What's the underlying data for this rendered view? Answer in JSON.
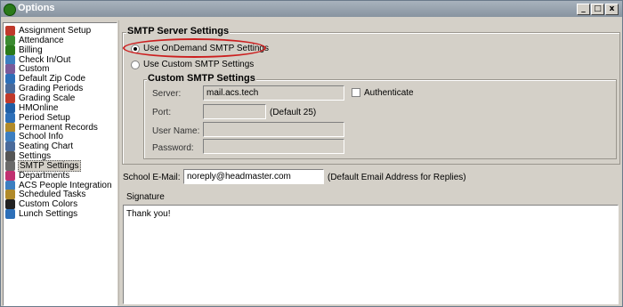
{
  "window": {
    "title": "Options",
    "min_label": "_",
    "max_label": "□",
    "close_label": "x"
  },
  "nav": {
    "selected": "SMTP Settings",
    "items": [
      {
        "label": "Assignment Setup",
        "icon": "target-icon",
        "color": "#c0392b"
      },
      {
        "label": "Attendance",
        "icon": "attendance-icon",
        "color": "#3b8a2f"
      },
      {
        "label": "Billing",
        "icon": "dollar-icon",
        "color": "#2a7a1a"
      },
      {
        "label": "Check In/Out",
        "icon": "check-in-out-icon",
        "color": "#3c7ec0"
      },
      {
        "label": "Custom",
        "icon": "custom-icon",
        "color": "#7a5a9a"
      },
      {
        "label": "Default Zip Code",
        "icon": "globe-icon",
        "color": "#2d6fb8"
      },
      {
        "label": "Grading Periods",
        "icon": "calendar-icon",
        "color": "#4a6a9a"
      },
      {
        "label": "Grading Scale",
        "icon": "target-icon",
        "color": "#c0392b"
      },
      {
        "label": "HMOnline",
        "icon": "globe-icon",
        "color": "#1f5fa6"
      },
      {
        "label": "Period Setup",
        "icon": "clock-icon",
        "color": "#2d6fb8"
      },
      {
        "label": "Permanent Records",
        "icon": "folder-icon",
        "color": "#b08a2a"
      },
      {
        "label": "School Info",
        "icon": "school-icon",
        "color": "#3c7ec0"
      },
      {
        "label": "Seating Chart",
        "icon": "chart-icon",
        "color": "#4a6a9a"
      },
      {
        "label": "Settings",
        "icon": "settings-icon",
        "color": "#555555"
      },
      {
        "label": "SMTP Settings",
        "icon": "mail-icon",
        "color": "#6a6a6a"
      },
      {
        "label": "Departments",
        "icon": "departments-icon",
        "color": "#c03070"
      },
      {
        "label": "ACS People Integration",
        "icon": "people-icon",
        "color": "#3c7ec0"
      },
      {
        "label": "Scheduled Tasks",
        "icon": "tasks-icon",
        "color": "#b08a2a"
      },
      {
        "label": "Custom Colors",
        "icon": "palette-icon",
        "color": "#222222"
      },
      {
        "label": "Lunch Settings",
        "icon": "lunch-icon",
        "color": "#2d6fb8"
      }
    ]
  },
  "smtp": {
    "group_title": "SMTP Server Settings",
    "option_ondemand": "Use OnDemand SMTP Settings",
    "option_custom": "Use Custom SMTP Settings",
    "selected": "ondemand",
    "custom_group_title": "Custom SMTP Settings",
    "server_label": "Server:",
    "server_value": "mail.acs.tech",
    "authenticate_label": "Authenticate",
    "authenticate_checked": false,
    "port_label": "Port:",
    "port_value": "",
    "port_hint": "(Default 25)",
    "username_label": "User Name:",
    "username_value": "",
    "password_label": "Password:",
    "password_value": "",
    "email_label": "School E-Mail:",
    "email_value": "noreply@headmaster.com",
    "email_hint": "(Default Email Address for Replies)",
    "signature_label": "Signature",
    "signature_value": "Thank you!"
  },
  "colors": {
    "highlight_ellipse": "#cc1f1f",
    "panel_bg": "#d4d0c8"
  }
}
